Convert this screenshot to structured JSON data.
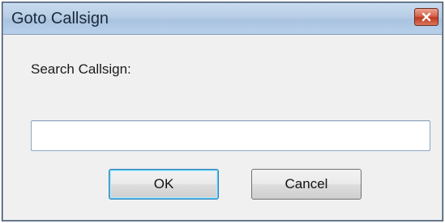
{
  "window": {
    "title": "Goto Callsign",
    "close_icon": "close-icon"
  },
  "form": {
    "label": "Search Callsign:",
    "input_value": "",
    "input_placeholder": ""
  },
  "buttons": {
    "ok_label": "OK",
    "cancel_label": "Cancel"
  },
  "colors": {
    "titlebar": "#b7cde6",
    "close_button": "#c0391f",
    "dialog_background": "#f0f0f0",
    "default_button_focus": "#48c6f4"
  }
}
